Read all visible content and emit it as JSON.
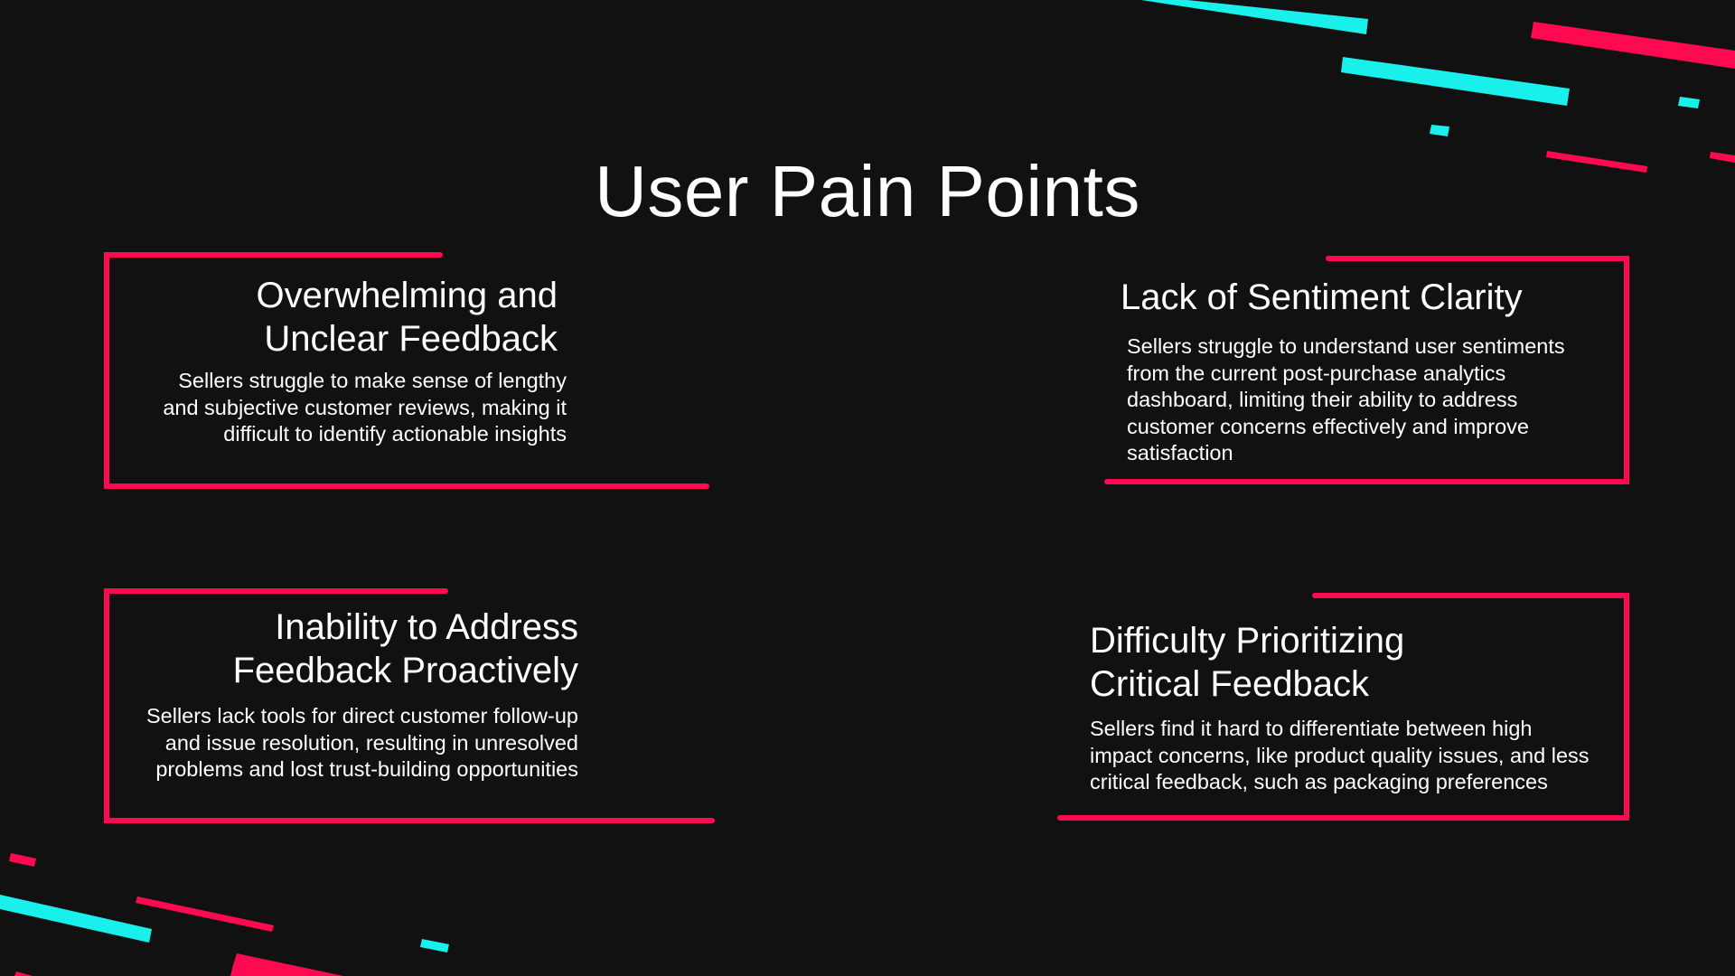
{
  "slide": {
    "title": "User Pain Points"
  },
  "cards": [
    {
      "title": "Overwhelming and\nUnclear Feedback",
      "body": "Sellers struggle to make sense of lengthy\nand subjective customer reviews, making it\ndifficult to identify actionable insights"
    },
    {
      "title": "Lack of Sentiment Clarity",
      "body": "Sellers struggle to understand user sentiments\nfrom the current post-purchase analytics\ndashboard, limiting their ability to address\ncustomer concerns effectively and improve\nsatisfaction"
    },
    {
      "title": "Inability to Address\nFeedback Proactively",
      "body": "Sellers lack tools for direct customer follow-up\nand issue resolution, resulting in unresolved\nproblems and lost trust-building opportunities"
    },
    {
      "title": "Difficulty Prioritizing\nCritical Feedback",
      "body": "Sellers find it hard to differentiate between high\nimpact concerns, like product quality issues, and less\ncritical feedback, such as packaging preferences"
    }
  ],
  "colors": {
    "background": "#111112",
    "frame_accent": "#ff0a50",
    "cyan_accent": "#19f0eb",
    "text": "#ffffff"
  }
}
